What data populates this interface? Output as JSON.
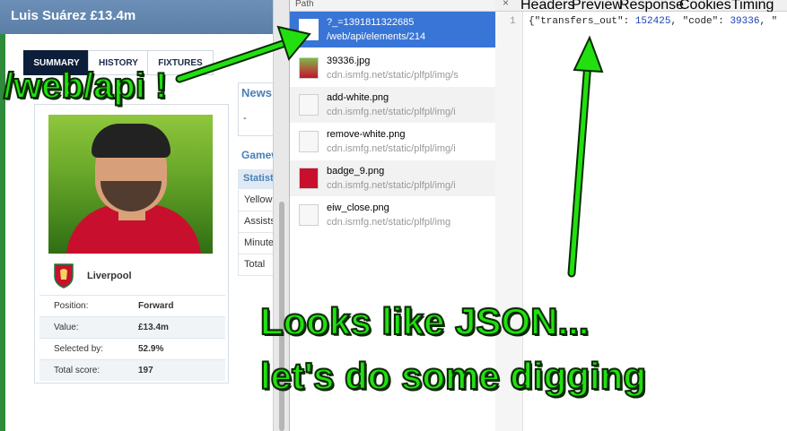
{
  "player_panel": {
    "title": "Luis Suárez £13.4m",
    "tabs": [
      "SUMMARY",
      "HISTORY",
      "FIXTURES"
    ],
    "club": "Liverpool",
    "stats": [
      {
        "label": "Position:",
        "value": "Forward"
      },
      {
        "label": "Value:",
        "value": "£13.4m"
      },
      {
        "label": "Selected by:",
        "value": "52.9%"
      },
      {
        "label": "Total score:",
        "value": "197"
      }
    ],
    "news_title": "News",
    "news_value": "-",
    "gameweek_title": "Gamew",
    "gameweek_header": "Statist",
    "gameweek_rows": [
      "Yellow",
      "Assists",
      "Minutes",
      "Total"
    ]
  },
  "network_panel": {
    "header": "Path",
    "rows": [
      {
        "name": "?_=1391811322685",
        "url": "/web/api/elements/214",
        "selected": true
      },
      {
        "name": "39336.jpg",
        "url": "cdn.ismfg.net/static/plfpl/img/s"
      },
      {
        "name": "add-white.png",
        "url": "cdn.ismfg.net/static/plfpl/img/i"
      },
      {
        "name": "remove-white.png",
        "url": "cdn.ismfg.net/static/plfpl/img/i"
      },
      {
        "name": "badge_9.png",
        "url": "cdn.ismfg.net/static/plfpl/img/i"
      },
      {
        "name": "eiw_close.png",
        "url": "cdn.ismfg.net/static/plfpl/img"
      }
    ]
  },
  "response_panel": {
    "close": "×",
    "tabs": [
      "Headers",
      "Preview",
      "Response",
      "Cookies",
      "Timing"
    ],
    "line_number": "1",
    "code_prefix": "{\"transfers_out\": ",
    "code_value1": "152425",
    "code_mid": ", \"code\": ",
    "code_value2": "39336",
    "code_suffix": ", \""
  },
  "annotations": {
    "webapi": "/web/api !",
    "json_line1": "Looks like JSON...",
    "json_line2": "let's do some digging"
  },
  "colors": {
    "selected_row": "#3875d7",
    "annotation_green": "#22e010",
    "header_blue": "#5a7ea6"
  }
}
